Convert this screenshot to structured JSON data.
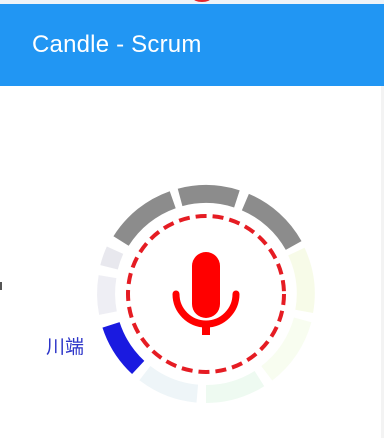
{
  "app_bar": {
    "title": "Candle - Scrum"
  },
  "side_label": "川端",
  "icons": {
    "mic": "microphone-icon"
  },
  "colors": {
    "app_bar": "#2196f3",
    "mic": "#ff0000",
    "ring_dashes": "#e51c23",
    "segment_active": "#1a1ae0",
    "segment_speaking": "#8c8c8c",
    "side_label": "#2c34c8"
  }
}
